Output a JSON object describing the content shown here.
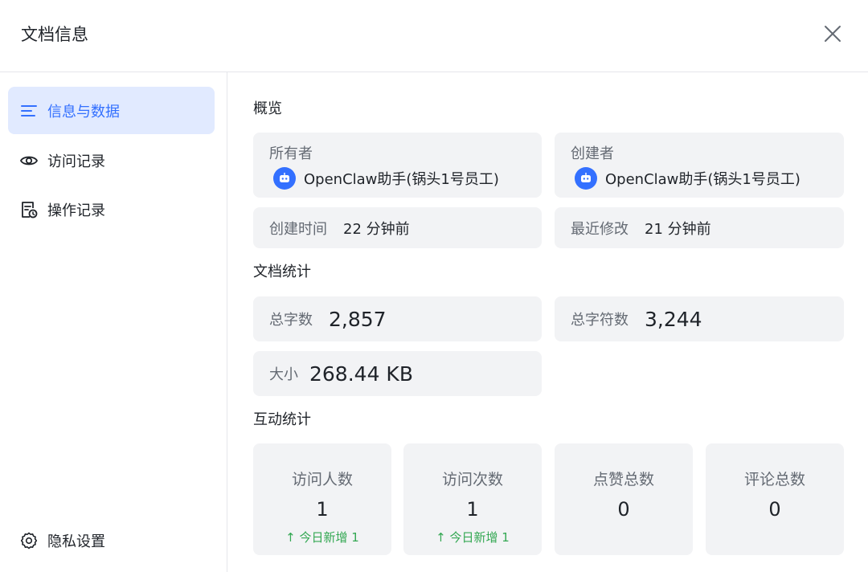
{
  "header": {
    "title": "文档信息",
    "close_icon": "close-icon"
  },
  "sidebar": {
    "items": [
      {
        "label": "信息与数据",
        "icon": "list-icon",
        "active": true
      },
      {
        "label": "访问记录",
        "icon": "eye-icon",
        "active": false
      },
      {
        "label": "操作记录",
        "icon": "doc-history-icon",
        "active": false
      }
    ],
    "footer": {
      "label": "隐私设置",
      "icon": "gear-icon"
    }
  },
  "overview": {
    "title": "概览",
    "owner": {
      "label": "所有者",
      "name": "OpenClaw助手(锅头1号员工)",
      "avatar_icon": "robot-icon"
    },
    "creator": {
      "label": "创建者",
      "name": "OpenClaw助手(锅头1号员工)",
      "avatar_icon": "robot-icon"
    },
    "created": {
      "label": "创建时间",
      "value": "22 分钟前"
    },
    "modified": {
      "label": "最近修改",
      "value": "21 分钟前"
    }
  },
  "doc_stats": {
    "title": "文档统计",
    "words": {
      "label": "总字数",
      "value": "2,857"
    },
    "chars": {
      "label": "总字符数",
      "value": "3,244"
    },
    "size": {
      "label": "大小",
      "value": "268.44 KB"
    }
  },
  "interaction_stats": {
    "title": "互动统计",
    "cards": [
      {
        "label": "访问人数",
        "value": "1",
        "delta": "↑ 今日新增 1"
      },
      {
        "label": "访问次数",
        "value": "1",
        "delta": "↑ 今日新增 1"
      },
      {
        "label": "点赞总数",
        "value": "0",
        "delta": ""
      },
      {
        "label": "评论总数",
        "value": "0",
        "delta": ""
      }
    ]
  },
  "colors": {
    "accent": "#3370ff",
    "active_bg": "#e1eaff",
    "card_bg": "#f2f3f5",
    "positive": "#34a853"
  }
}
